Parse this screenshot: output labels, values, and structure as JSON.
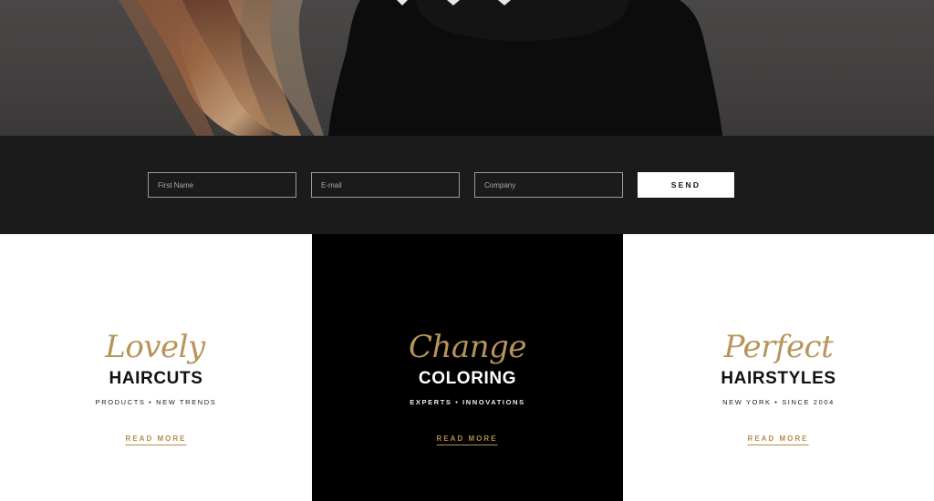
{
  "hero": {
    "image_description_icon": "hero-photo-icon"
  },
  "contact": {
    "first_name_placeholder": "First Name",
    "email_placeholder": "E-mail",
    "company_placeholder": "Company",
    "send_label": "SEND"
  },
  "features": [
    {
      "script": "Lovely",
      "title": "HAIRCUTS",
      "subtitle": "PRODUCTS • NEW TRENDS",
      "link": "READ MORE"
    },
    {
      "script": "Change",
      "title": "COLORING",
      "subtitle": "EXPERTS • INNOVATIONS",
      "link": "READ MORE"
    },
    {
      "script": "Perfect",
      "title": "HAIRSTYLES",
      "subtitle": "NEW YORK • SINCE 2004",
      "link": "READ MORE"
    }
  ],
  "colors": {
    "accent_gold": "#b58d48",
    "script_gold": "#b89459",
    "contact_bg": "#1b1b1b",
    "dark_column_bg": "#000000"
  }
}
